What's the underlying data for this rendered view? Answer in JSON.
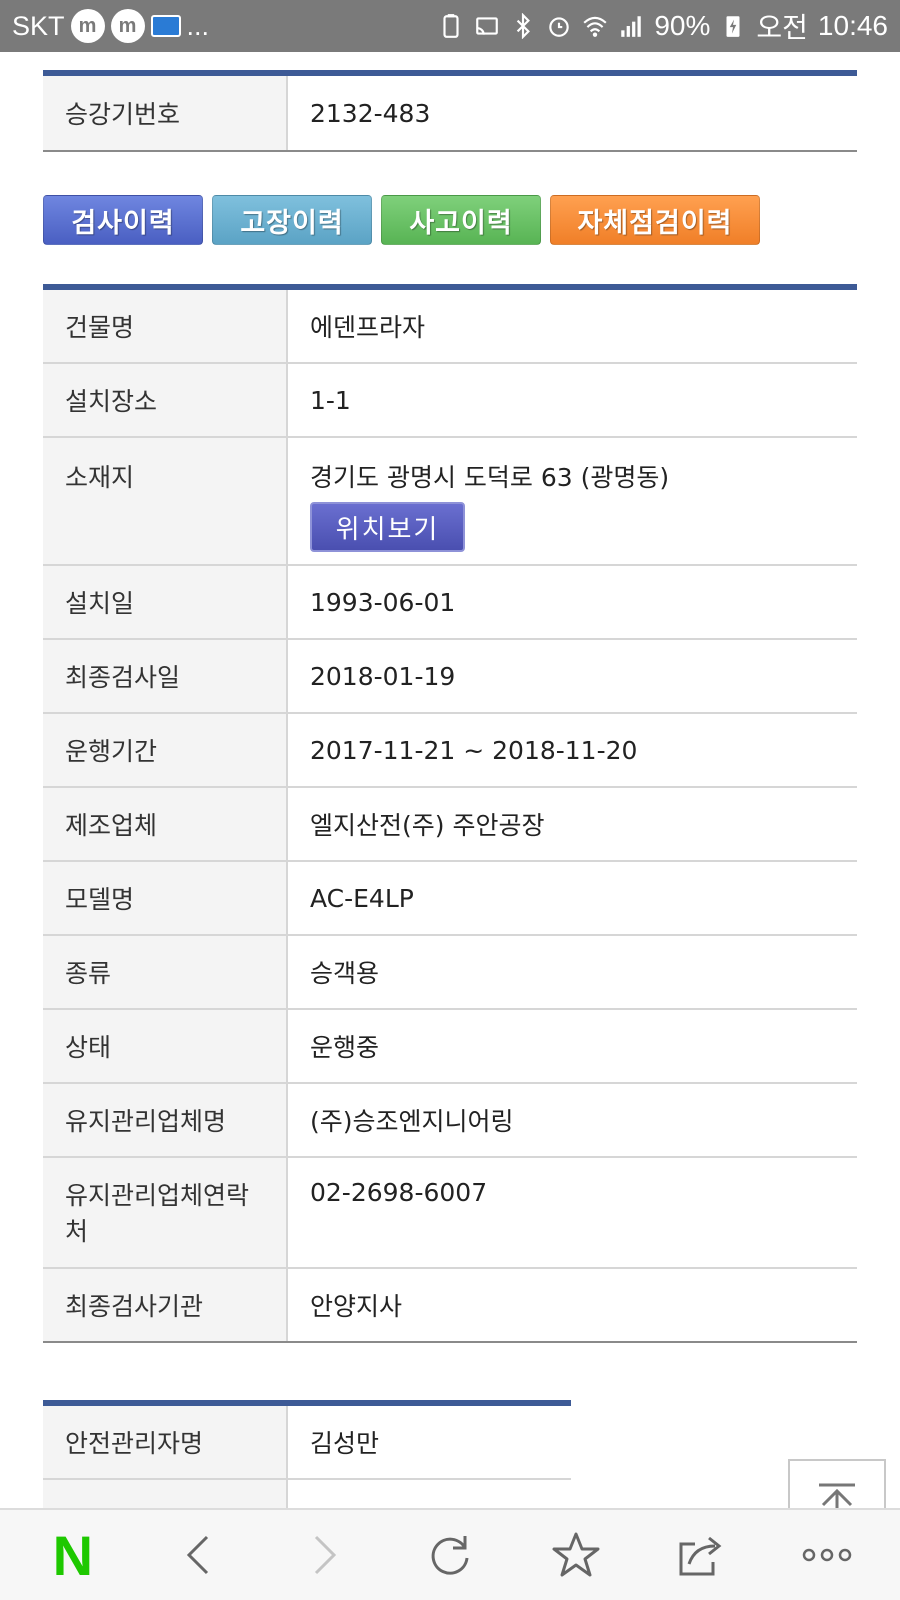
{
  "status_bar": {
    "carrier": "SKT",
    "more": "...",
    "battery": "90%",
    "ampm": "오전",
    "time": "10:46"
  },
  "elevator_no": {
    "label": "승강기번호",
    "value": "2132-483"
  },
  "history_buttons": [
    "검사이력",
    "고장이력",
    "사고이력",
    "자체점검이력"
  ],
  "details": {
    "building": {
      "label": "건물명",
      "value": "에덴프라자"
    },
    "install_place": {
      "label": "설치장소",
      "value": "1-1"
    },
    "address": {
      "label": "소재지",
      "value": "경기도 광명시 도덕로 63 (광명동)",
      "map_button": "위치보기"
    },
    "install_date": {
      "label": "설치일",
      "value": "1993-06-01"
    },
    "last_inspection": {
      "label": "최종검사일",
      "value": "2018-01-19"
    },
    "operation_period": {
      "label": "운행기간",
      "value": "2017-11-21 ~ 2018-11-20"
    },
    "manufacturer": {
      "label": "제조업체",
      "value": "엘지산전(주) 주안공장"
    },
    "model": {
      "label": "모델명",
      "value": "AC-E4LP"
    },
    "type": {
      "label": "종류",
      "value": "승객용"
    },
    "status": {
      "label": "상태",
      "value": "운행중"
    },
    "maintenance_company": {
      "label": "유지관리업체명",
      "value": "(주)승조엔지니어링"
    },
    "maintenance_contact": {
      "label": "유지관리업체연락처",
      "value": "02-2698-6007"
    },
    "inspection_agency": {
      "label": "최종검사기관",
      "value": "안양지사"
    }
  },
  "safety": {
    "manager": {
      "label": "안전관리자명",
      "value": "김성만"
    }
  },
  "bottom_nav": {
    "logo": "N",
    "icons": [
      "back-icon",
      "forward-icon",
      "refresh-icon",
      "bookmark-star-icon",
      "share-icon",
      "more-icon"
    ]
  },
  "colors": {
    "table_top": "#3d5a96",
    "btn_inspection": "#5a70d0",
    "btn_fault": "#6db2d2",
    "btn_accident": "#6bc267",
    "btn_selfcheck": "#f58a35",
    "naver_green": "#1ec800"
  }
}
